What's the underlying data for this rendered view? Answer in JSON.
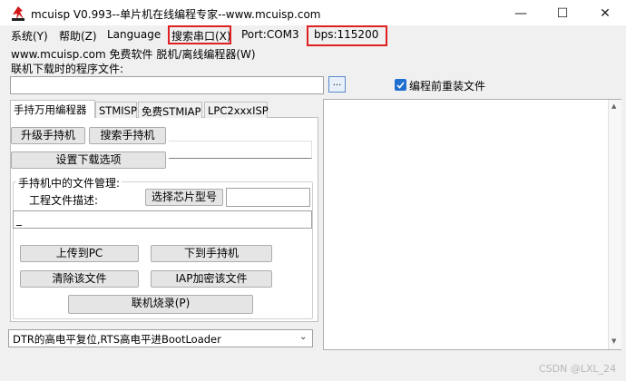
{
  "window": {
    "title": "mcuisp V0.993--单片机在线编程专家--www.mcuisp.com",
    "minimize_label": "—",
    "maximize_label": "☐",
    "close_label": "✕"
  },
  "menu": {
    "items": [
      "系统(Y)",
      "帮助(Z)",
      "Language",
      "搜索串口(X)",
      "Port:COM3",
      "bps:115200"
    ],
    "highlight_color": "#e02020"
  },
  "header": {
    "subtitle": "www.mcuisp.com 免费软件 脱机/离线编程器(W)",
    "download_label": "联机下载时的程序文件:"
  },
  "file_row": {
    "file_value": "",
    "browse_label": "...",
    "reload_checked": true,
    "reload_label": "编程前重装文件"
  },
  "tabs": [
    "手持万用编程器",
    "STMISP",
    "免费STMIAP",
    "LPC2xxxISP"
  ],
  "programmer": {
    "upgrade_button": "升级手持机",
    "search_button": "搜索手持机",
    "download_options_button": "设置下载选项",
    "file_mgmt_title": "手持机中的文件管理:",
    "project_desc_label": "工程文件描述:",
    "select_chip_button": "选择芯片型号",
    "description_value": "_",
    "upload_button": "上传到PC",
    "download_button": "下到手持机",
    "clear_button": "清除该文件",
    "iap_encrypt_button": "IAP加密该文件",
    "online_burn_button": "联机烧录(P)"
  },
  "reset_mode": {
    "selected": "DTR的高电平复位,RTS高电平进BootLoader"
  },
  "watermark": "CSDN @LXL_24"
}
